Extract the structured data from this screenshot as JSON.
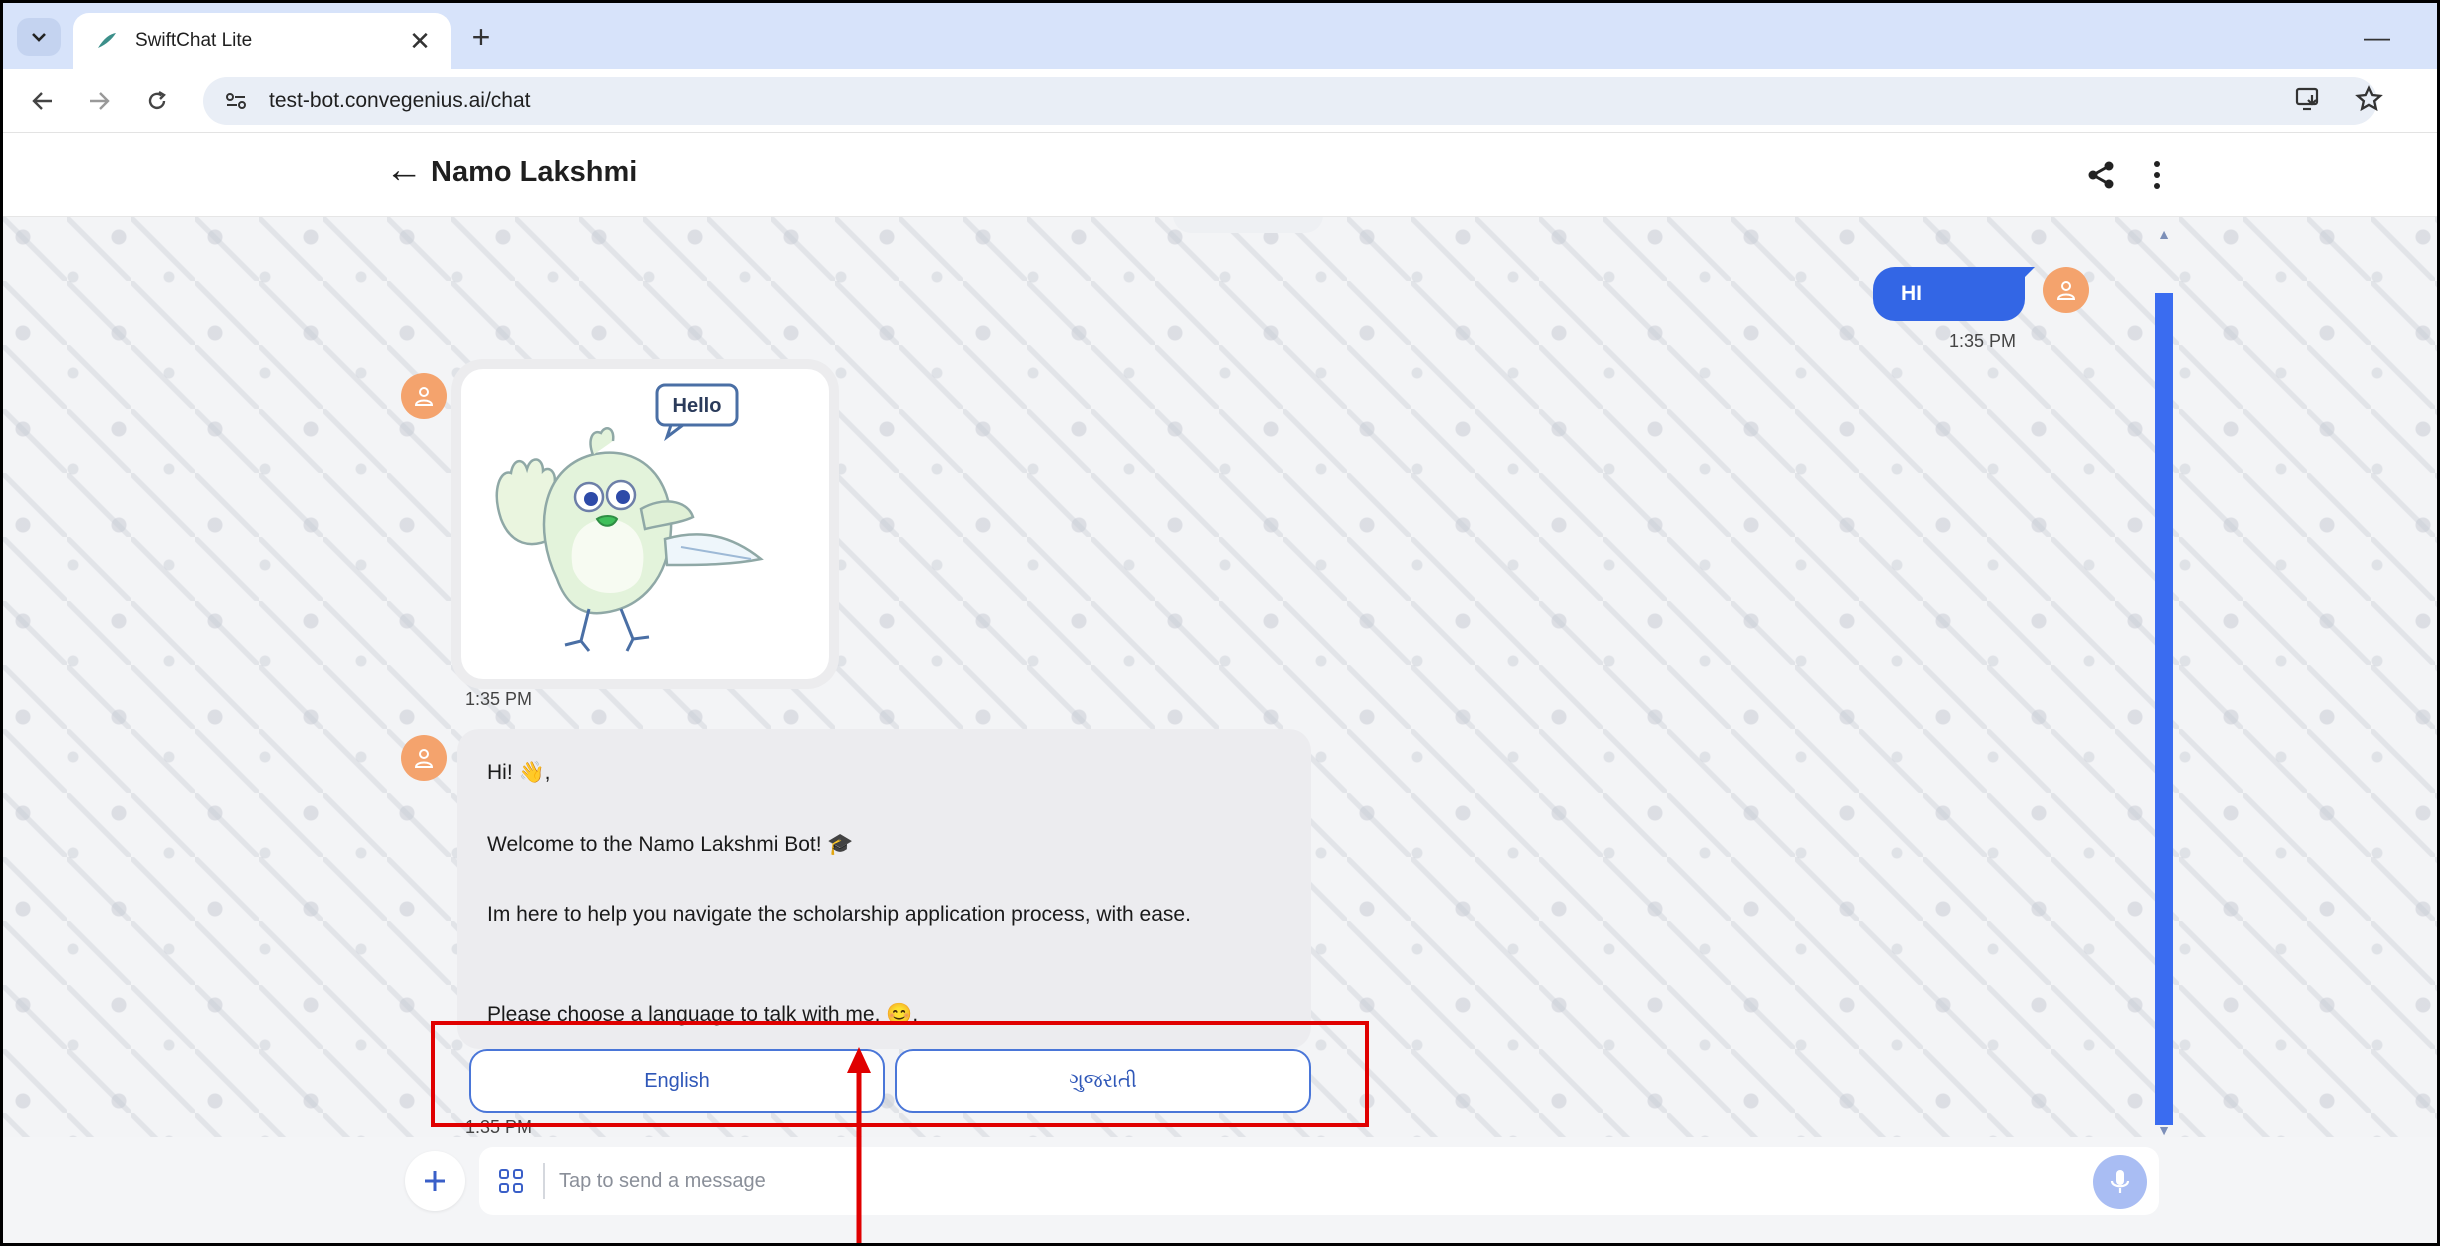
{
  "browser": {
    "tab_title": "SwiftChat Lite",
    "tab_close": "✕",
    "new_tab": "+",
    "minimize": "—",
    "url": "test-bot.convegenius.ai/chat"
  },
  "chat": {
    "back_glyph": "←",
    "title": "Namo Lakshmi"
  },
  "messages": {
    "user_text": "HI",
    "user_time": "1:35 PM",
    "sticker_text": "Hello",
    "sticker_time": "1:35 PM",
    "bot_lines": [
      "Hi! 👋,",
      "Welcome to the Namo Lakshmi Bot! 🎓",
      "Im here to help you navigate the scholarship application process, with ease.",
      "Please choose a language to talk with me. 😊."
    ],
    "bot_time": "1:35 PM"
  },
  "choices": [
    "English",
    "ગુજરાતી"
  ],
  "composer": {
    "placeholder": "Tap to send a message"
  },
  "colors": {
    "accent": "#3366e5",
    "avatar": "#f4a36d",
    "highlight": "#e00000"
  }
}
